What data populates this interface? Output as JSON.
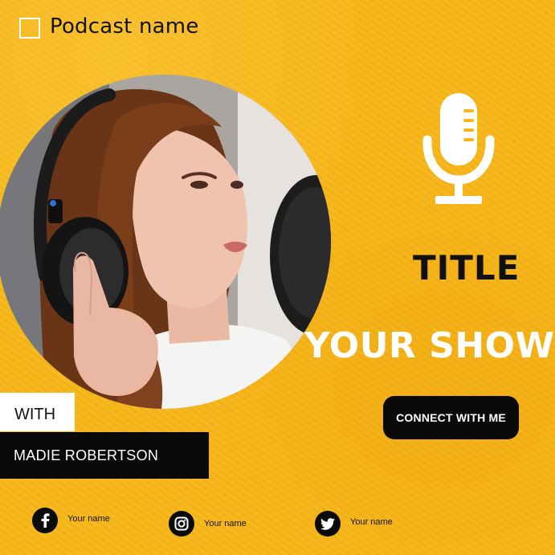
{
  "header": {
    "podcast_name": "Podcast name"
  },
  "hero": {
    "title": "TITLE",
    "subtitle": "YOUR SHOW"
  },
  "cta": {
    "connect_label": "CONNECT WITH ME"
  },
  "host": {
    "with_label": "WITH",
    "name": "MADIE ROBERTSON"
  },
  "social": [
    {
      "icon": "facebook-icon",
      "label": "Your name"
    },
    {
      "icon": "instagram-icon",
      "label": "Your name"
    },
    {
      "icon": "twitter-icon",
      "label": "Your name"
    }
  ],
  "colors": {
    "background": "#f8b718",
    "dark": "#0a0a0a",
    "light": "#ffffff"
  }
}
